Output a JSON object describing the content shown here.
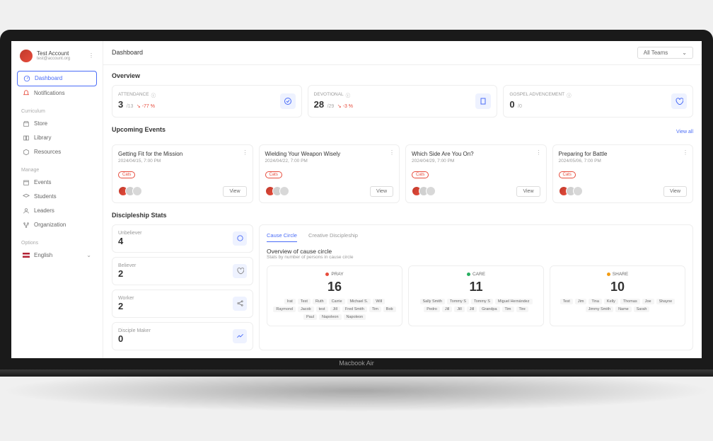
{
  "laptop_label": "Macbook Air",
  "user": {
    "name": "Test Account",
    "email": "test@account.org"
  },
  "nav": {
    "dashboard": "Dashboard",
    "notifications": "Notifications",
    "curriculum_label": "Curriculum",
    "store": "Store",
    "library": "Library",
    "resources": "Resources",
    "manage_label": "Manage",
    "events": "Events",
    "students": "Students",
    "leaders": "Leaders",
    "organization": "Organization",
    "options_label": "Options",
    "language": "English"
  },
  "topbar": {
    "title": "Dashboard",
    "team_select": "All Teams"
  },
  "overview": {
    "title": "Overview",
    "attendance": {
      "label": "ATTENDANCE",
      "value": "3",
      "total": "/13",
      "delta": "-77 %"
    },
    "devotional": {
      "label": "DEVOTIONAL",
      "value": "28",
      "total": "/29",
      "delta": "-3 %"
    },
    "gospel": {
      "label": "GOSPEL ADVENCEMENT",
      "value": "0",
      "total": "/0"
    }
  },
  "events": {
    "title": "Upcoming Events",
    "view_all": "View all",
    "view_btn": "View",
    "tag": "Cats",
    "items": [
      {
        "title": "Getting Fit for the Mission",
        "date": "2024/04/15, 7:00 PM"
      },
      {
        "title": "Wielding Your Weapon Wisely",
        "date": "2024/04/22, 7:00 PM"
      },
      {
        "title": "Which Side Are You On?",
        "date": "2024/04/29, 7:00 PM"
      },
      {
        "title": "Preparing for Battle",
        "date": "2024/05/06, 7:00 PM"
      }
    ]
  },
  "discipleship": {
    "title": "Discipleship Stats",
    "mini": [
      {
        "label": "Unbeliever",
        "value": "4"
      },
      {
        "label": "Believer",
        "value": "2"
      },
      {
        "label": "Worker",
        "value": "2"
      },
      {
        "label": "Disciple Maker",
        "value": "0"
      }
    ],
    "tabs": {
      "cause": "Cause Circle",
      "creative": "Creative Discipleship"
    },
    "cc_title": "Overview of cause circle",
    "cc_sub": "Stats by number of persons in cause circle",
    "circles": {
      "pray": {
        "label": "PRAY",
        "count": "16",
        "names": [
          "Irat",
          "Test",
          "Ruth",
          "Carrie",
          "Michael S.",
          "Will",
          "Raymond",
          "Jacob",
          "test",
          "Jill",
          "Fred Smith",
          "Tim",
          "Bob",
          "Paul",
          "Napoleon",
          "Napoleon"
        ]
      },
      "care": {
        "label": "CARE",
        "count": "11",
        "names": [
          "Sally Smith",
          "Tommy S",
          "Tommy S",
          "Miguel Hernández",
          "Pedro",
          "Jill",
          "Jill",
          "Jill",
          "Grandpa",
          "Tim",
          "Tire"
        ]
      },
      "share": {
        "label": "SHARE",
        "count": "10",
        "names": [
          "Test",
          "Jim",
          "Tina",
          "Kelly",
          "Thomas",
          "Joe",
          "Shayne",
          "Jimmy Smith",
          "Name",
          "Sarah"
        ]
      }
    }
  }
}
